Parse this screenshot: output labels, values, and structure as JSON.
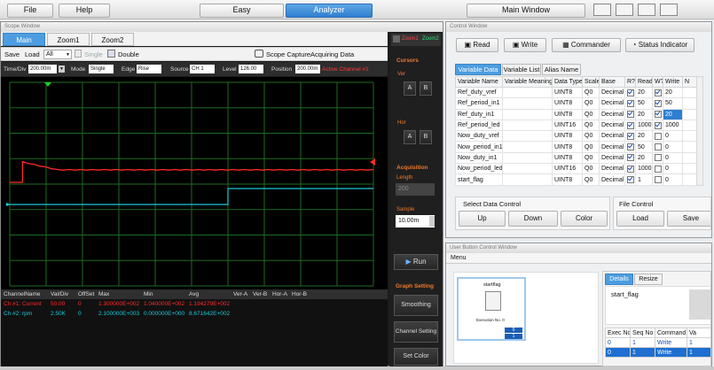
{
  "topbar": {
    "file": "File",
    "help": "Help",
    "easy": "Easy",
    "analyzer": "Analyzer",
    "main_window": "Main Window"
  },
  "scope": {
    "title": "Scope Window",
    "tabs": [
      "Main",
      "Zoom1",
      "Zoom2"
    ],
    "zoom_tabs_right": [
      "Zoom1",
      "Zoom2"
    ],
    "toolbar": {
      "save": "Save",
      "load": "Load",
      "all": "All",
      "single": "Single",
      "double": "Double",
      "capture": "Scope Capture",
      "acquiring": "Acquiring Data"
    },
    "settings": {
      "timediv_label": "Time/Div",
      "timediv": "200.00m",
      "mode_label": "Mode",
      "mode": "Single",
      "edge_label": "Edge",
      "edge": "Rise",
      "source_label": "Source",
      "source": "CH 1",
      "level_label": "Level",
      "level": "126.00",
      "position_label": "Position",
      "position": "200.00m",
      "active_channel": "Active Channel #1"
    },
    "colors": {
      "ch1": "#ff2a2a",
      "ch2": "#1ec8d6",
      "grid": "#1f6b1f",
      "trigger": "#18d018"
    },
    "right_panel": {
      "cursors": "Cursors",
      "ver": "Ver",
      "hor": "Hor",
      "a": "A",
      "b": "B",
      "acquisition": "Acquisition",
      "length": "Length",
      "length_value": "200",
      "sample": "Sample",
      "sample_value": "10.00m",
      "run": "Run",
      "graph_setting": "Graph Setting",
      "smoothing": "Smoothing",
      "channel_setting": "Channel Setting",
      "set_color": "Set Color"
    },
    "channel_table": {
      "headers": [
        "ChannelName",
        "Val/Div",
        "OffSet",
        "Max",
        "Min",
        "Avg",
        "Ver-A",
        "Ver-B",
        "Hor-A",
        "Hor-B"
      ],
      "rows": [
        [
          "Ch #1: Current",
          "50.00",
          "0",
          "1.300000E+002",
          "1.040000E+002",
          "1.194279E+002",
          "",
          "",
          "",
          ""
        ],
        [
          "Ch #2: rpm",
          "2.50K",
          "0",
          "2.100000E+003",
          "0.000000E+000",
          "8.671642E+002",
          "",
          "",
          "",
          ""
        ]
      ]
    }
  },
  "control": {
    "title": "Control Window",
    "buttons": [
      "Read",
      "Write",
      "Commander",
      "Status Indicator"
    ],
    "tabs": [
      "Variable Data",
      "Variable List",
      "Alias Name"
    ],
    "headers": [
      "Variable Name",
      "Variable Meaning",
      "Data Type",
      "Scale",
      "Base",
      "R?",
      "Read",
      "W?",
      "Write",
      "N"
    ],
    "rows": [
      {
        "name": "Ref_duty_vref",
        "type": "UINT8",
        "scale": "Q0",
        "base": "Decimal",
        "r": true,
        "read": "20",
        "w": true,
        "write": "20"
      },
      {
        "name": "Ref_period_in1",
        "type": "UINT8",
        "scale": "Q0",
        "base": "Decimal",
        "r": true,
        "read": "50",
        "w": true,
        "write": "50"
      },
      {
        "name": "Ref_duty_in1",
        "type": "UINT8",
        "scale": "Q0",
        "base": "Decimal",
        "r": true,
        "read": "20",
        "w": true,
        "write": "20"
      },
      {
        "name": "Ref_period_led",
        "type": "UINT16",
        "scale": "Q0",
        "base": "Decimal",
        "r": true,
        "read": "1000",
        "w": true,
        "write": "1000"
      },
      {
        "name": "Now_duty_vref",
        "type": "UINT8",
        "scale": "Q0",
        "base": "Decimal",
        "r": true,
        "read": "20",
        "w": false,
        "write": "0"
      },
      {
        "name": "Now_period_in1",
        "type": "UINT8",
        "scale": "Q0",
        "base": "Decimal",
        "r": true,
        "read": "50",
        "w": false,
        "write": "0"
      },
      {
        "name": "Now_duty_in1",
        "type": "UINT8",
        "scale": "Q0",
        "base": "Decimal",
        "r": true,
        "read": "20",
        "w": false,
        "write": "0"
      },
      {
        "name": "Now_period_led",
        "type": "UINT16",
        "scale": "Q0",
        "base": "Decimal",
        "r": true,
        "read": "1000",
        "w": false,
        "write": "0"
      },
      {
        "name": "start_flag",
        "type": "UINT8",
        "scale": "Q0",
        "base": "Decimal",
        "r": true,
        "read": "1",
        "w": false,
        "write": "0"
      }
    ],
    "select_data_control": "Select Data Control",
    "up": "Up",
    "down": "Down",
    "color": "Color",
    "file_control": "File Control",
    "load": "Load",
    "save": "Save"
  },
  "user": {
    "title": "User Button Control Window",
    "menu": "Menu",
    "card_label": "startflag",
    "execution_no": "Execution No.  0",
    "card_value_1": "0",
    "card_value_2": "1",
    "tabs": [
      "Details",
      "Resize"
    ],
    "details_name": "start_flag",
    "exec_headers": [
      "Exec No",
      "Seq No",
      "Command",
      "Va"
    ],
    "exec_rows": [
      [
        "0",
        "1",
        "Write",
        "1"
      ],
      [
        "0",
        "1",
        "Write",
        "1"
      ]
    ]
  },
  "chart_data": {
    "type": "line",
    "series": [
      {
        "name": "Ch #1: Current",
        "color": "#ff2a2a",
        "x": [
          0.0,
          0.35,
          0.35,
          10.0
        ],
        "y": [
          104,
          104,
          130,
          120
        ]
      },
      {
        "name": "Ch #2: rpm",
        "color": "#1ec8d6",
        "x": [
          0.0,
          6.0,
          6.0,
          10.0
        ],
        "y": [
          0,
          0,
          2100,
          2100
        ]
      }
    ]
  }
}
